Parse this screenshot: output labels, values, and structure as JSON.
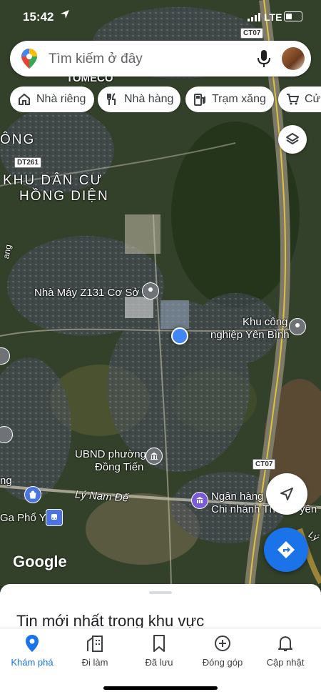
{
  "status_bar": {
    "time": "15:42",
    "network": "LTE"
  },
  "search": {
    "placeholder": "Tìm kiếm ở đây"
  },
  "chips": [
    {
      "label": "Nhà riêng",
      "icon": "home-icon"
    },
    {
      "label": "Nhà hàng",
      "icon": "restaurant-icon"
    },
    {
      "label": "Trạm xăng",
      "icon": "gas-station-icon"
    },
    {
      "label": "Cửa",
      "icon": "shopping-cart-icon"
    }
  ],
  "map": {
    "labels": {
      "tomeco": "TOMECO",
      "ong": "ÔNG",
      "khu_dan_cu_1": "KHU DÂN CƯ",
      "khu_dan_cu_2": "HỒNG DIỆN",
      "nha_may": "Nhà Máy Z131 Cơ Sở 1",
      "khu_cong_nghiep_1": "Khu công",
      "khu_cong_nghiep_2": "nghiệp Yên Bình",
      "ubnd_1": "UBND phường",
      "ubnd_2": "Đồng Tiến",
      "ly_nam_de": "Lý Nam Đế",
      "ngan_hang_1": "Ngân hàng S",
      "ngan_hang_2": "Chi nhánh Th",
      "ngan_hang_tail": "yên",
      "ga_pho_yen": "Ga Phổ Yên",
      "ng": "ng",
      "ly": "Lý",
      "ang": "ang"
    },
    "road_shields": {
      "ct07_top": "CT07",
      "ct07_mid": "CT07",
      "dt261": "DT261"
    },
    "attribution": "Google"
  },
  "sheet": {
    "title": "Tin mới nhất trong khu vực"
  },
  "nav": [
    {
      "label": "Khám phá",
      "icon": "explore-pin-icon",
      "active": true
    },
    {
      "label": "Đi làm",
      "icon": "commute-building-icon",
      "active": false
    },
    {
      "label": "Đã lưu",
      "icon": "bookmark-icon",
      "active": false
    },
    {
      "label": "Đóng góp",
      "icon": "add-circle-icon",
      "active": false
    },
    {
      "label": "Cập nhật",
      "icon": "bell-icon",
      "active": false
    }
  ],
  "colors": {
    "accent": "#1a73e8",
    "location_dot": "#4285f4"
  }
}
